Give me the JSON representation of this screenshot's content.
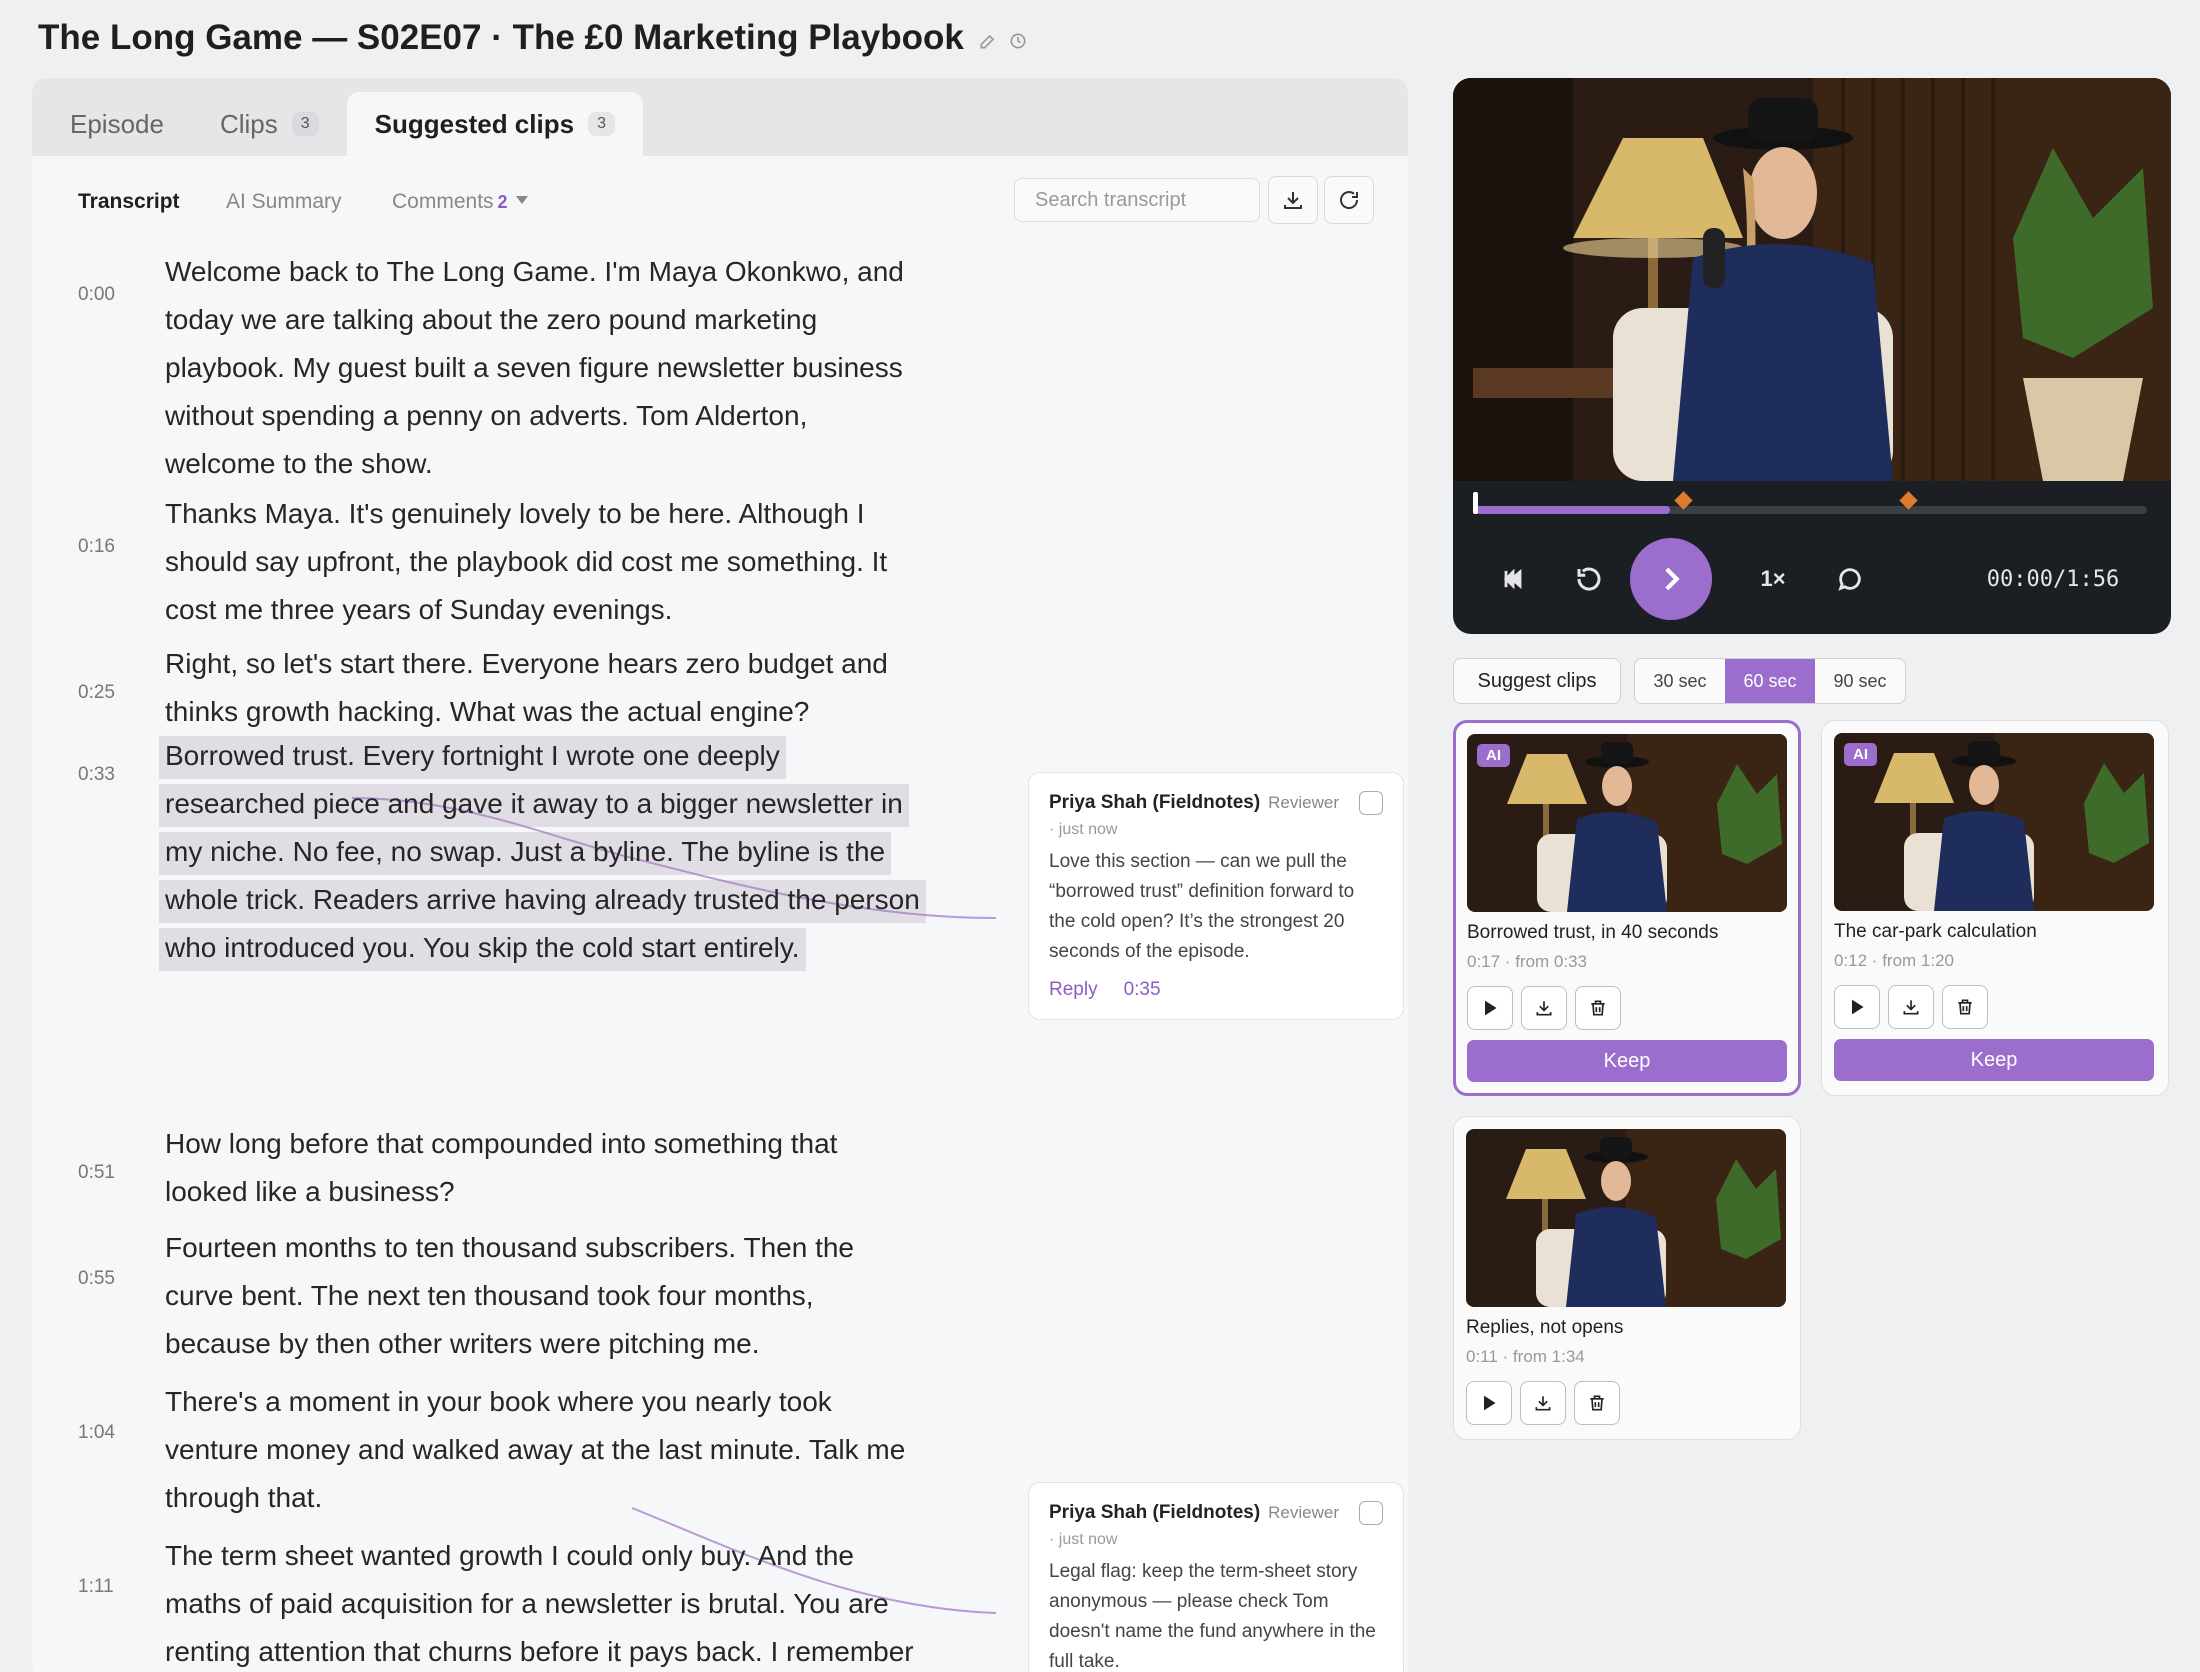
{
  "page": {
    "title": "The Long Game — S02E07 · The £0 Marketing Playbook"
  },
  "tabs": [
    {
      "label": "Episode",
      "badge": ""
    },
    {
      "label": "Clips",
      "badge": "3"
    },
    {
      "label": "Suggested clips",
      "badge": "3",
      "active": true
    }
  ],
  "subtabs": {
    "transcript": "Transcript",
    "summary": "AI Summary",
    "comments": "Comments",
    "comments_count": "2"
  },
  "search": {
    "placeholder": "Search transcript"
  },
  "transcript": [
    {
      "time": "0:00",
      "text": "Welcome back to The Long Game. I'm Maya Okonkwo, and today we are talking about the zero pound marketing playbook. My guest built a seven figure newsletter business without spending a penny on adverts. Tom Alderton, welcome to the show."
    },
    {
      "time": "0:16",
      "text": "Thanks Maya. It's genuinely lovely to be here. Although I should say upfront, the playbook did cost me something. It cost me three years of Sunday evenings."
    },
    {
      "time": "0:25",
      "text": "Right, so let's start there. Everyone hears zero budget and thinks growth hacking. What was the actual engine?"
    },
    {
      "time": "0:33",
      "text": "Borrowed trust. Every fortnight I wrote one deeply researched piece and gave it away to a bigger newsletter in my niche. No fee, no swap. Just a byline. The byline is the whole trick. Readers arrive having already trusted the person who introduced you. You skip the cold start entirely.",
      "highlighted": true
    },
    {
      "time": "0:51",
      "text": "How long before that compounded into something that looked like a business?"
    },
    {
      "time": "0:55",
      "text": "Fourteen months to ten thousand subscribers. Then the curve bent. The next ten thousand took four months, because by then other writers were pitching me."
    },
    {
      "time": "1:04",
      "text": "There's a moment in your book where you nearly took venture money and walked away at the last minute. Talk me through that."
    },
    {
      "time": "1:11",
      "text": "The term sheet wanted growth I could only buy. And the maths of paid acquisition for a newsletter is brutal. You are renting attention that churns before it pays back. I remember sitting in the car park afterwards doing the"
    }
  ],
  "comments": [
    {
      "author": "Priya Shah (Fieldnotes)",
      "role": "Reviewer",
      "time": "· just now",
      "body": "Love this section — can we pull the “borrowed trust” definition forward to the cold open? It’s the strongest 20 seconds of the episode.",
      "reply": "Reply",
      "timestamp": "0:35"
    },
    {
      "author": "Priya Shah (Fieldnotes)",
      "role": "Reviewer",
      "time": "· just now",
      "body": "Legal flag: keep the term-sheet story anonymous — please check Tom doesn't name the fund anywhere in the full take."
    }
  ],
  "player": {
    "timecode": "00:00/1:56",
    "speed": "1×",
    "progress": 0.29,
    "markers": [
      0.31,
      0.645
    ]
  },
  "clip_controls": {
    "suggest_label": "Suggest clips",
    "durations": [
      "30 sec",
      "60 sec",
      "90 sec"
    ],
    "selected_duration": "60 sec"
  },
  "clips": [
    {
      "title": "Borrowed trust, in 40 seconds",
      "meta": "0:17 · from 0:33",
      "ai": "AI",
      "keep": "Keep",
      "selected": true
    },
    {
      "title": "The car-park calculation",
      "meta": "0:12 · from 1:20",
      "ai": "AI",
      "keep": "Keep"
    },
    {
      "title": "Replies, not opens",
      "meta": "0:11 · from 1:34"
    }
  ],
  "colors": {
    "accent": "#9b6dcc",
    "marker": "#e07b2b",
    "player_bg": "#1b1f24",
    "highlight": "#dcd8e2"
  },
  "icons": [
    "edit-icon",
    "history-icon",
    "download-icon",
    "refresh-icon",
    "skip-back-icon",
    "replay-icon",
    "play-icon",
    "comment-icon",
    "trash-icon"
  ]
}
